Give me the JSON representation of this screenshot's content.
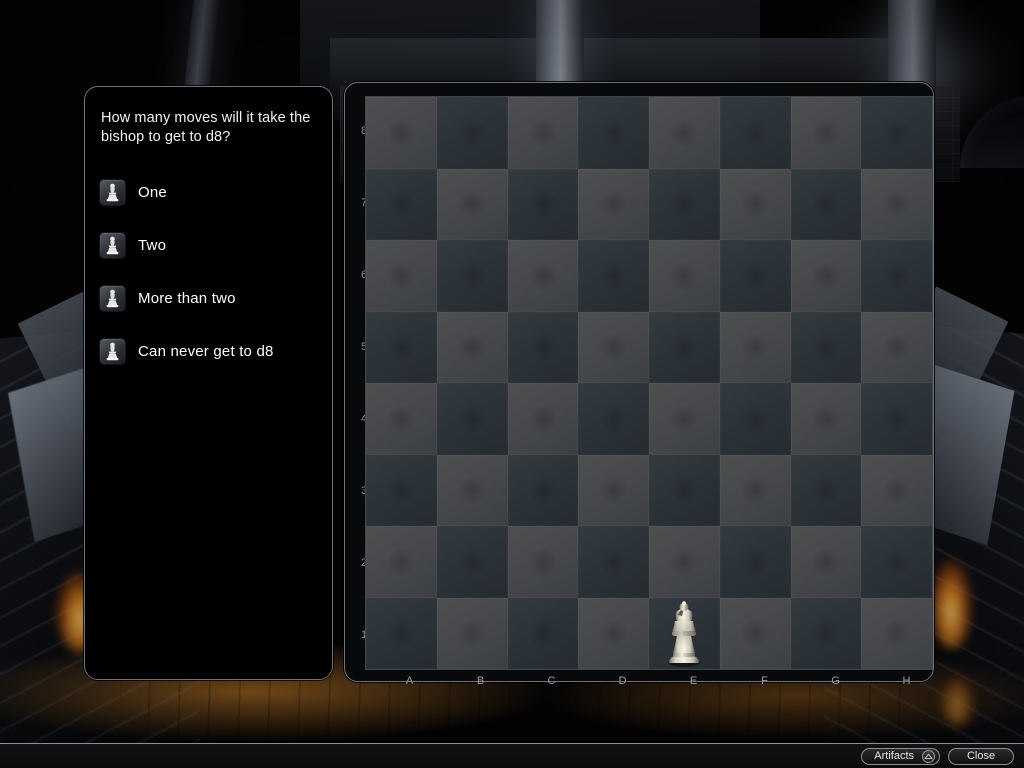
{
  "question": {
    "text": "How many moves will it take the bishop to get to d8?",
    "answers": [
      {
        "label": "One",
        "icon": "chess-piece-icon"
      },
      {
        "label": "Two",
        "icon": "chess-piece-icon"
      },
      {
        "label": "More than two",
        "icon": "chess-piece-icon"
      },
      {
        "label": "Can never get to d8",
        "icon": "chess-piece-icon"
      }
    ]
  },
  "board": {
    "rank_labels": [
      "8",
      "7",
      "6",
      "5",
      "4",
      "3",
      "2",
      "1"
    ],
    "file_labels": [
      "A",
      "B",
      "C",
      "D",
      "E",
      "F",
      "G",
      "H"
    ],
    "pieces": [
      {
        "square": "e1",
        "piece": "bishop",
        "color": "white",
        "file_index": 4,
        "rank_index": 7
      }
    ],
    "colors": {
      "light_square": "#474a4c",
      "dark_square": "#2c3338",
      "border": "#3f444a",
      "label": "#8c9097"
    }
  },
  "bottom_bar": {
    "artifacts_label": "Artifacts",
    "expand_icon": "chevron-up-icon",
    "close_label": "Close"
  },
  "theme": {
    "panel_background": "#000000",
    "panel_border": "#6f747b",
    "text": "#ffffff",
    "torch_glow": "#ff9620"
  }
}
